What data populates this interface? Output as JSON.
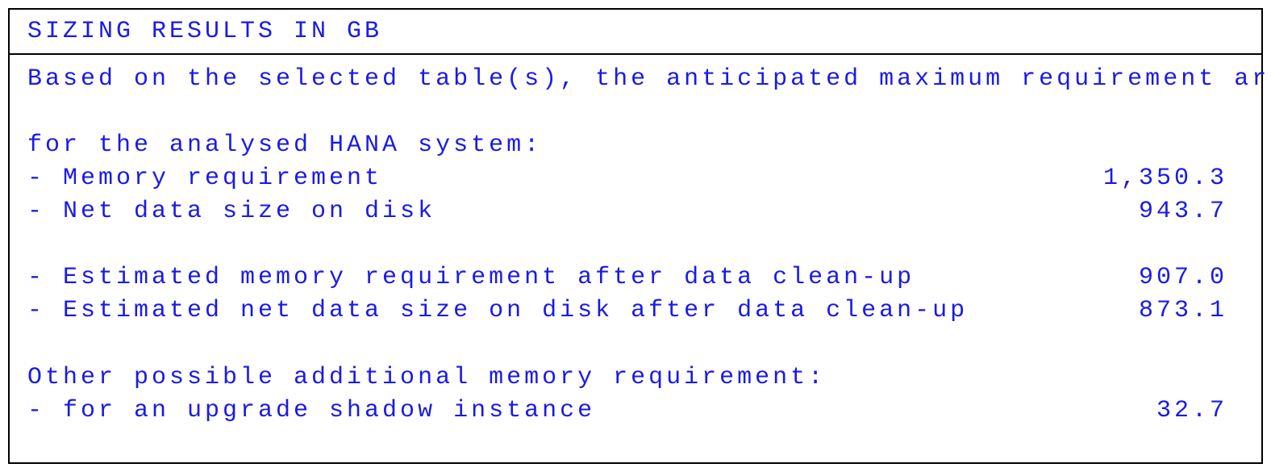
{
  "title": "SIZING RESULTS IN GB",
  "intro": "Based on the selected table(s), the anticipated maximum requirement are",
  "section1_heading": "for the analysed HANA system:",
  "rows": {
    "memory_req": {
      "label": "- Memory requirement",
      "value": "1,350.3"
    },
    "net_disk": {
      "label": "- Net data size on disk",
      "value": "943.7"
    },
    "est_memory": {
      "label": "- Estimated memory requirement after data clean-up",
      "value": "907.0"
    },
    "est_disk": {
      "label": "- Estimated net data size on disk after data clean-up",
      "value": "873.1"
    }
  },
  "section2_heading": "Other possible additional memory requirement:",
  "rows2": {
    "shadow": {
      "label": "- for an upgrade shadow instance",
      "value": "32.7"
    }
  }
}
